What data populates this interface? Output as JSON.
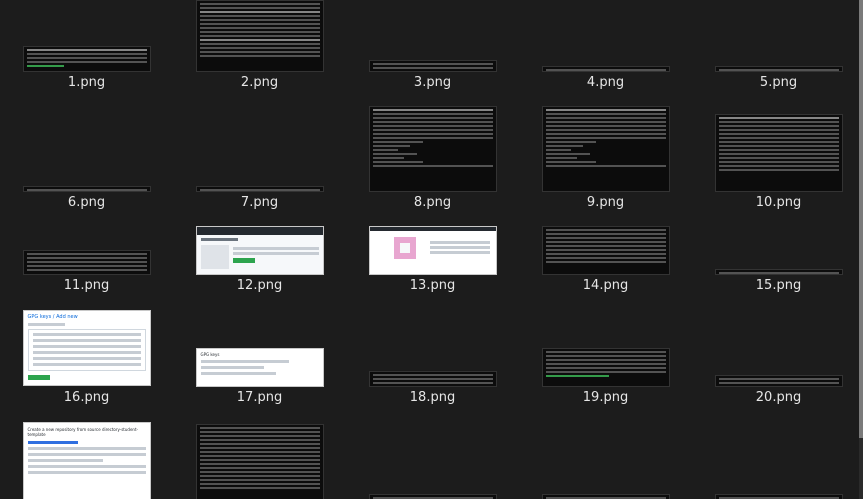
{
  "files": [
    {
      "name": "1.png"
    },
    {
      "name": "2.png"
    },
    {
      "name": "3.png"
    },
    {
      "name": "4.png"
    },
    {
      "name": "5.png"
    },
    {
      "name": "6.png"
    },
    {
      "name": "7.png"
    },
    {
      "name": "8.png"
    },
    {
      "name": "9.png"
    },
    {
      "name": "10.png"
    },
    {
      "name": "11.png"
    },
    {
      "name": "12.png"
    },
    {
      "name": "13.png"
    },
    {
      "name": "14.png"
    },
    {
      "name": "15.png"
    },
    {
      "name": "16.png"
    },
    {
      "name": "17.png"
    },
    {
      "name": "18.png"
    },
    {
      "name": "19.png"
    },
    {
      "name": "20.png"
    }
  ],
  "thumb_texts": {
    "t16_title": "GPG keys / Add new",
    "t17_title": "GPG keys",
    "t21_title": "Create a new repository from source directory-student-template"
  },
  "colors": {
    "background": "#1c1c1c",
    "terminal": "#0c0c0c",
    "github_green": "#2da44e"
  }
}
